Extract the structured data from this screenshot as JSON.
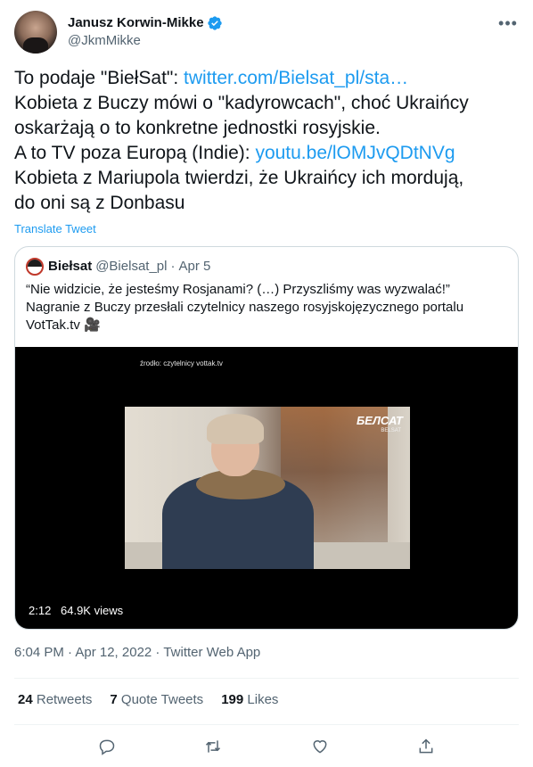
{
  "author": {
    "display_name": "Janusz Korwin-Mikke",
    "handle": "@JkmMikke",
    "verified": true
  },
  "tweet": {
    "lines": [
      {
        "pre": "To podaje \"BiełSat\": ",
        "link": "twitter.com/Bielsat_pl/sta…"
      },
      {
        "pre": "Kobieta z Buczy mówi o \"kadyrowcach\", choć Ukraińcy"
      },
      {
        "pre": "oskarżają o to konkretne jednostki rosyjskie."
      },
      {
        "pre": "A to TV poza Europą (Indie): ",
        "link": "youtu.be/lOMJvQDtNVg"
      },
      {
        "pre": "Kobieta z Mariupola twierdzi, że Ukraińcy ich mordują,"
      },
      {
        "pre": "do oni są z Donbasu"
      }
    ],
    "translate_label": "Translate Tweet"
  },
  "quote": {
    "name": "Biełsat",
    "handle": "@Bielsat_pl",
    "date": "Apr 5",
    "lines": [
      "“Nie widzicie, że jesteśmy Rosjanami? (…) Przyszliśmy was wyzwalać!”",
      "Nagranie z Buczy przesłali czytelnicy naszego rosyjskojęzycznego portalu",
      "VotTak.tv 🎥"
    ],
    "video": {
      "source_caption": "źrodło: czytelnicy vottak.tv",
      "logo": "БЕЛСАТ",
      "logo_sub": "BELSAT",
      "duration": "2:12",
      "views": "64.9K views"
    }
  },
  "meta": "6:04 PM · Apr 12, 2022 · Twitter Web App",
  "stats": {
    "retweets": {
      "count": "24",
      "label": "Retweets"
    },
    "quotes": {
      "count": "7",
      "label": "Quote Tweets"
    },
    "likes": {
      "count": "199",
      "label": "Likes"
    }
  },
  "colors": {
    "link": "#1d9bf0",
    "muted": "#536471",
    "text": "#0f1419"
  }
}
